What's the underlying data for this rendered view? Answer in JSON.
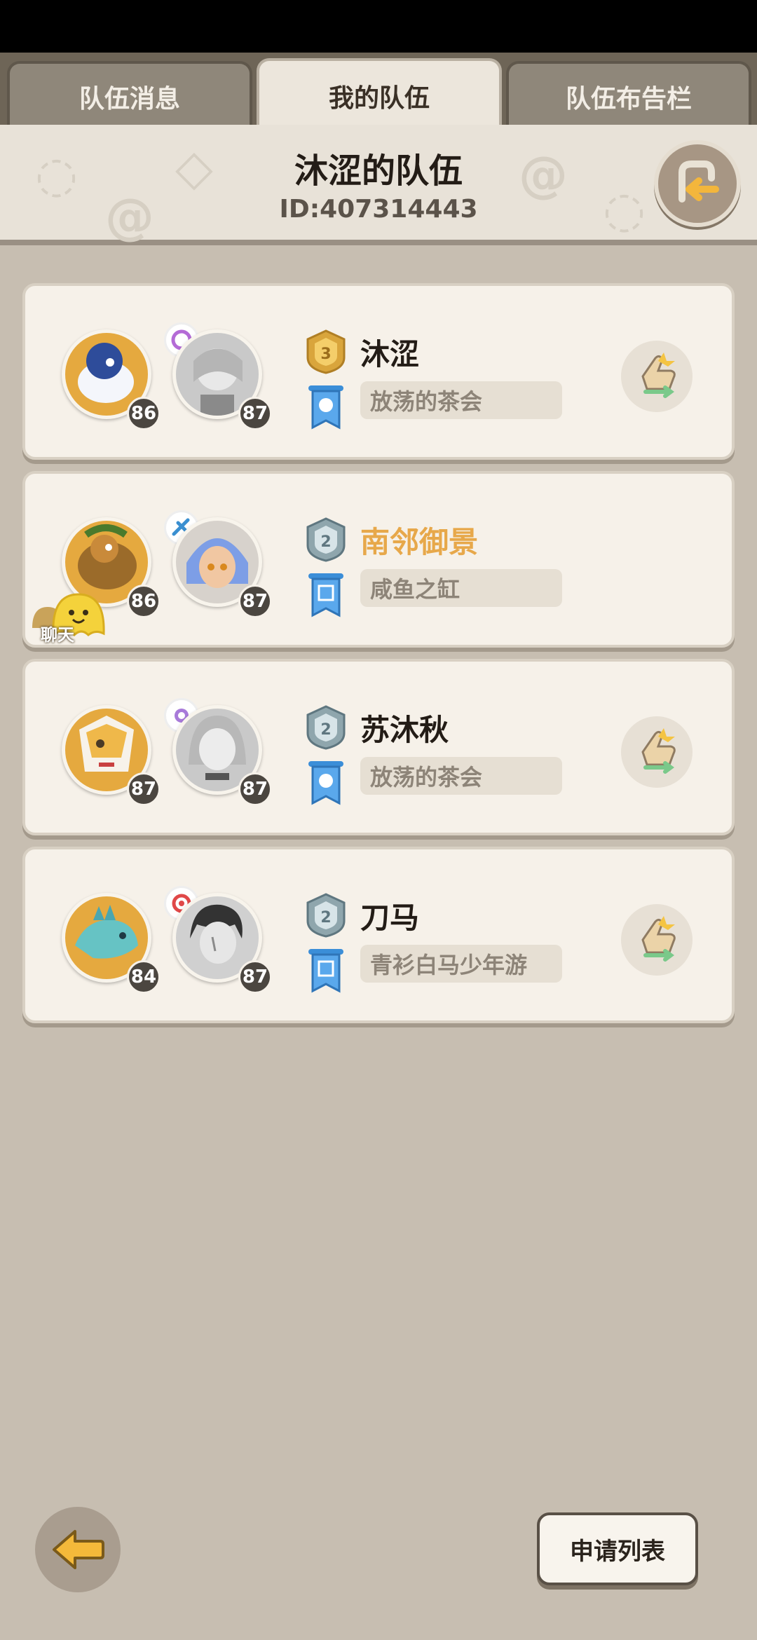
{
  "tabs": [
    {
      "label": "队伍消息",
      "active": false
    },
    {
      "label": "我的队伍",
      "active": true
    },
    {
      "label": "队伍布告栏",
      "active": false
    }
  ],
  "team": {
    "name": "沐涩的队伍",
    "id": "ID:407314443"
  },
  "members": [
    {
      "name": "沐涩",
      "guild": "放荡的茶会",
      "pet_level": "86",
      "char_level": "87",
      "rank": "gold",
      "name_color": "#231c16",
      "has_swap": true,
      "has_chat": false
    },
    {
      "name": "南邻御景",
      "guild": "咸鱼之缸",
      "pet_level": "86",
      "char_level": "87",
      "rank": "silver",
      "name_color": "#e7a84a",
      "has_swap": false,
      "has_chat": true
    },
    {
      "name": "苏沐秋",
      "guild": "放荡的茶会",
      "pet_level": "87",
      "char_level": "87",
      "rank": "silver",
      "name_color": "#231c16",
      "has_swap": true,
      "has_chat": false
    },
    {
      "name": "刀马",
      "guild": "青衫白马少年游",
      "pet_level": "84",
      "char_level": "87",
      "rank": "silver",
      "name_color": "#231c16",
      "has_swap": true,
      "has_chat": false
    }
  ],
  "chat": {
    "label": "聊天"
  },
  "bottom": {
    "apply_list_label": "申请列表"
  },
  "icons": {
    "exit": "exit-team-icon",
    "swap": "swap-hand-icon",
    "back": "back-arrow-icon",
    "rank_gold": "gold-rank-badge-icon",
    "rank_silver": "silver-rank-badge-icon",
    "guild": "guild-banner-icon"
  },
  "colors": {
    "accent_gold": "#e7a84a",
    "background": "#c7beb1",
    "card": "#f6f1e9"
  }
}
